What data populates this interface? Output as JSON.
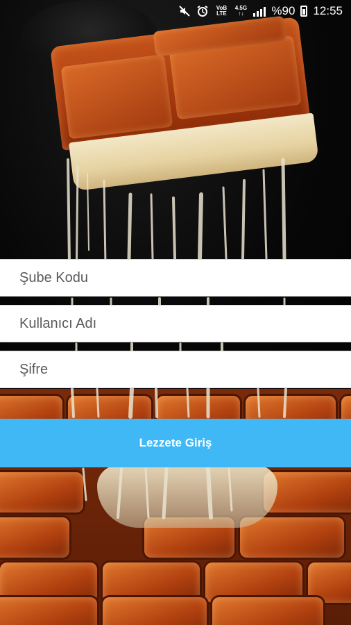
{
  "status_bar": {
    "network_label_top": "VoB",
    "network_label_bottom": "LTE",
    "data_top": "4.5G",
    "data_bottom": "↑↓",
    "battery_text": "%90",
    "time": "12:55",
    "icons": [
      "mute-icon",
      "alarm-icon",
      "volte-icon",
      "data-icon",
      "signal-icon",
      "battery-icon"
    ]
  },
  "login_form": {
    "branch_code_placeholder": "Şube Kodu",
    "username_placeholder": "Kullanıcı Adı",
    "password_placeholder": "Şifre",
    "submit_label": "Lezzete Giriş"
  },
  "colors": {
    "submit_button": "#3fb8f5",
    "field_background": "#ffffff"
  }
}
